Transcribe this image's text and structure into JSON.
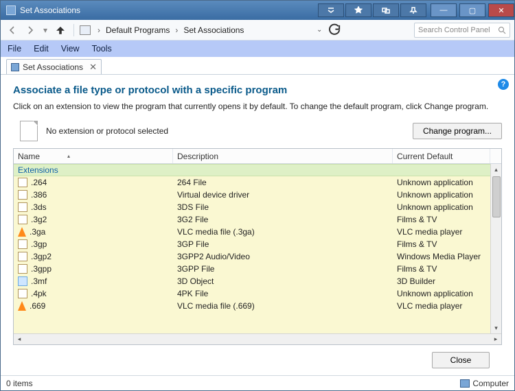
{
  "window": {
    "title": "Set Associations"
  },
  "titlebar_buttons": {
    "minimize": "—",
    "maximize": "▢",
    "close": "✕"
  },
  "breadcrumb": {
    "item1": "Default Programs",
    "item2": "Set Associations"
  },
  "search": {
    "placeholder": "Search Control Panel"
  },
  "menu": {
    "file": "File",
    "edit": "Edit",
    "view": "View",
    "tools": "Tools"
  },
  "tab": {
    "label": "Set Associations"
  },
  "page": {
    "heading": "Associate a file type or protocol with a specific program",
    "description": "Click on an extension to view the program that currently opens it by default. To change the default program, click Change program.",
    "no_selection": "No extension or protocol selected",
    "change_btn": "Change program...",
    "close_btn": "Close"
  },
  "columns": {
    "name": "Name",
    "desc": "Description",
    "def": "Current Default"
  },
  "group": {
    "label": "Extensions"
  },
  "rows": [
    {
      "ext": ".264",
      "desc": "264 File",
      "def": "Unknown application",
      "ico": "plain"
    },
    {
      "ext": ".386",
      "desc": "Virtual device driver",
      "def": "Unknown application",
      "ico": "plain"
    },
    {
      "ext": ".3ds",
      "desc": "3DS File",
      "def": "Unknown application",
      "ico": "plain"
    },
    {
      "ext": ".3g2",
      "desc": "3G2 File",
      "def": "Films & TV",
      "ico": "plain"
    },
    {
      "ext": ".3ga",
      "desc": "VLC media file (.3ga)",
      "def": "VLC media player",
      "ico": "cone"
    },
    {
      "ext": ".3gp",
      "desc": "3GP File",
      "def": "Films & TV",
      "ico": "plain"
    },
    {
      "ext": ".3gp2",
      "desc": "3GPP2 Audio/Video",
      "def": "Windows Media Player",
      "ico": "plain"
    },
    {
      "ext": ".3gpp",
      "desc": "3GPP File",
      "def": "Films & TV",
      "ico": "plain"
    },
    {
      "ext": ".3mf",
      "desc": "3D Object",
      "def": "3D Builder",
      "ico": "blue"
    },
    {
      "ext": ".4pk",
      "desc": "4PK File",
      "def": "Unknown application",
      "ico": "plain"
    },
    {
      "ext": ".669",
      "desc": "VLC media file (.669)",
      "def": "VLC media player",
      "ico": "cone"
    }
  ],
  "status": {
    "items": "0 items",
    "computer": "Computer"
  }
}
